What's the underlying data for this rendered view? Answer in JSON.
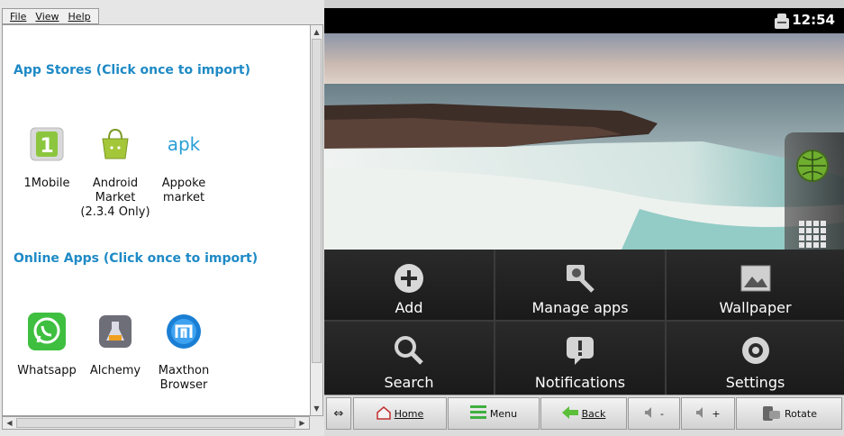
{
  "menu": {
    "file": "File",
    "view": "View",
    "help": "Help"
  },
  "sections": {
    "app_stores": "App Stores (Click once to import)",
    "online_apps": "Online Apps (Click once to import)"
  },
  "app_stores": [
    {
      "label": "1Mobile",
      "icon": "1mobile-icon"
    },
    {
      "label": "Android Market (2.3.4 Only)",
      "icon": "android-market-icon"
    },
    {
      "label": "Appoke market",
      "icon": "appoke-icon",
      "icon_text": "apk"
    }
  ],
  "online_apps": [
    {
      "label": "Whatsapp",
      "icon": "whatsapp-icon"
    },
    {
      "label": "Alchemy",
      "icon": "alchemy-icon"
    },
    {
      "label": "Maxthon Browser",
      "icon": "maxthon-icon"
    }
  ],
  "android": {
    "clock": "12:54",
    "menu_items": [
      {
        "label": "Add",
        "icon": "add-icon"
      },
      {
        "label": "Manage apps",
        "icon": "manage-apps-icon"
      },
      {
        "label": "Wallpaper",
        "icon": "wallpaper-icon"
      },
      {
        "label": "Search",
        "icon": "search-icon"
      },
      {
        "label": "Notifications",
        "icon": "notifications-icon"
      },
      {
        "label": "Settings",
        "icon": "settings-icon"
      }
    ]
  },
  "toolbar": {
    "home": "Home",
    "menu": "Menu",
    "back": "Back",
    "vol_down": "-",
    "vol_up": "+",
    "rotate": "Rotate"
  },
  "colors": {
    "section_title": "#1e8ac6",
    "android_bg": "#222222"
  }
}
